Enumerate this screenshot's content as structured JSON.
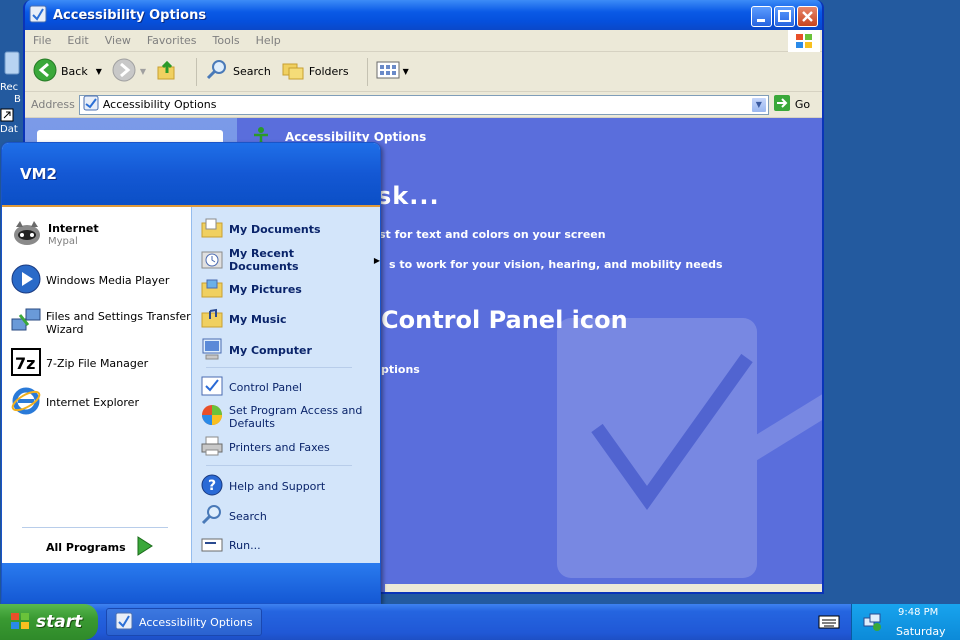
{
  "window": {
    "title": "Accessibility Options",
    "menu": [
      "File",
      "Edit",
      "View",
      "Favorites",
      "Tools",
      "Help"
    ],
    "toolbar": {
      "back": "Back",
      "search": "Search",
      "folders": "Folders"
    },
    "address": {
      "label": "Address",
      "value": "Accessibility Options",
      "go": "Go"
    },
    "content": {
      "header": "Accessibility Options",
      "pick_task": "sk...",
      "task1": "st for text and colors on your screen",
      "task2": "s to work for your vision, hearing, and mobility needs",
      "pick_icon": "Control Panel icon",
      "icon1": "ptions"
    }
  },
  "desktop": {
    "icon1": "Rec",
    "icon1b": "B",
    "icon2": "Dat"
  },
  "start_menu": {
    "user": "VM2",
    "pinned": [
      {
        "label": "Internet",
        "sub": "Mypal"
      }
    ],
    "recent": [
      "Windows Media Player",
      "Files and Settings Transfer",
      "Wizard",
      "7-Zip File Manager",
      "Internet Explorer"
    ],
    "all_programs": "All Programs",
    "right": {
      "my_documents": "My Documents",
      "my_recent": "My Recent Documents",
      "my_pictures": "My Pictures",
      "my_music": "My Music",
      "my_computer": "My Computer",
      "control_panel": "Control Panel",
      "set_program_1": "Set Program Access and",
      "set_program_2": "Defaults",
      "printers": "Printers and Faxes",
      "help": "Help and Support",
      "search": "Search",
      "run": "Run..."
    }
  },
  "taskbar": {
    "start": "start",
    "task": "Accessibility Options",
    "time": "9:48 PM",
    "day": "Saturday"
  }
}
